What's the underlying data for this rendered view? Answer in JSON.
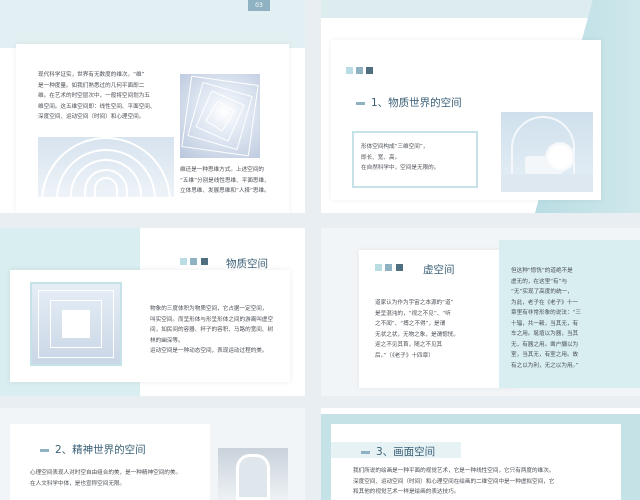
{
  "colors": {
    "accent_light": "#b9dde3",
    "accent_mid": "#8fb2c2",
    "accent_dark": "#4f6f80",
    "frame": "#c5e3e7",
    "text": "#4a4f55",
    "heading": "#3a5f76"
  },
  "slide1": {
    "page_num": "03",
    "paragraph": "现代科学证实，世界有无数度的维次。“维”\n是一种度量。如我们熟悉过的几何平面即二\n维。在艺术的时空层次中，一般将空间划为五\n维空间。这五维空间即：线性空间、平面空间、\n深度空间、运动空间（时间）和心理空间。",
    "caption": "维还是一种思维方式。上述空间的\n“五维”分别是线性思维、平面思维、\n立体思维、发展思维和“人择”思维。"
  },
  "slide2": {
    "heading": "1、物质世界的空间",
    "text": "形体空间构成“三维空间”，\n即长、宽、高。\n在自然科学中，空间是无限的。"
  },
  "slide3": {
    "heading": "物质空间",
    "text": "物象的三度体积为物质空间，它占据一定空间，\n叫实空间。而呈形体与形呈形体之间的游离叫虚空\n间，如民间的容器、杯子的容积、马路的宽间、树\n林的幽深等。\n运动空间是一种动态空间，表现运动过程的美。"
  },
  "slide4": {
    "heading": "虚空间",
    "left_text": "道家认为作为宇宙之本源的“道”\n是呈混沌的，“视之不见”、“听\n之不闻”、“搏之不得”，是谓\n无状之状，无物之象，是谓惚恍。\n迎之不见其首，随之不见其\n后。”（《老子》十四章）",
    "right_text": "但这种“惚恍”的道绝不是\n虚无的，在这里“有”与\n“无”实现了高度的统一，\n为此，老子在《老子》十一\n章里有非常形象的说法：“三\n十辐，共一毂，当其无，有\n车之用。埏埴以为器，当其\n无，有器之用。凿户牖以为\n室，当其无，有室之用。故\n有之以为利，无之以为用。”"
  },
  "slide5": {
    "heading": "2、精神世界的空间",
    "text": "心理空间表现人对时空自由组合的美，是一种精神空间的美。\n在人文科学中体，是也宣称空间无限。"
  },
  "slide6": {
    "heading": "3、画面空间",
    "text": "我们所说的绘画是一种平面的视觉艺术，它是一种线性空间，它只有两度的维次。\n深度空间、运动空间（时间）和心理空间在绘画的二维空间中是一种虚拟空间，它\n和其他的视觉艺术一样是绘画的表达技巧。"
  }
}
